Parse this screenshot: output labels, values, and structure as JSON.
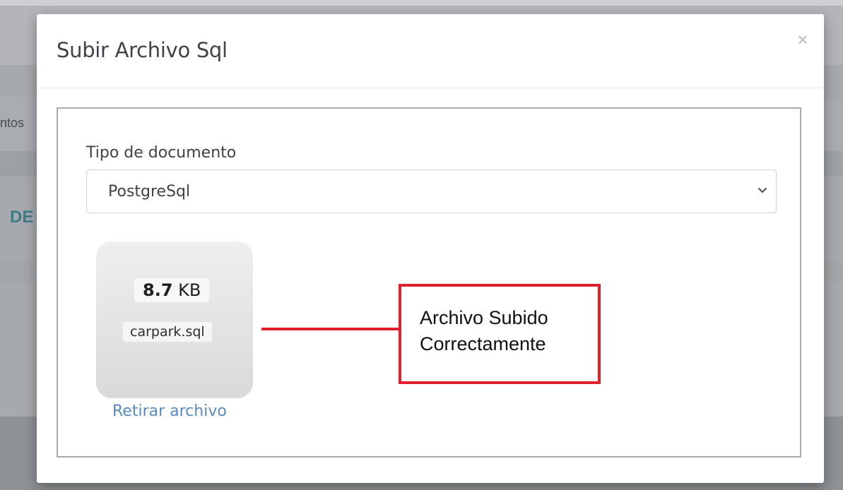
{
  "background": {
    "partial_text_1": "ntos",
    "partial_text_2": "DE"
  },
  "modal": {
    "title": "Subir Archivo Sql",
    "close_symbol": "×",
    "close_icon": "close-icon"
  },
  "form": {
    "document_type_label": "Tipo de documento",
    "document_type_value": "PostgreSql",
    "chevron_icon": "chevron-down-icon"
  },
  "file": {
    "size_number": "8.7",
    "size_unit": "KB",
    "name": "carpark.sql",
    "remove_label": "Retirar archivo"
  },
  "annotation": {
    "line1": "Archivo Subido",
    "line2": "Correctamente",
    "color": "#e0202c"
  }
}
